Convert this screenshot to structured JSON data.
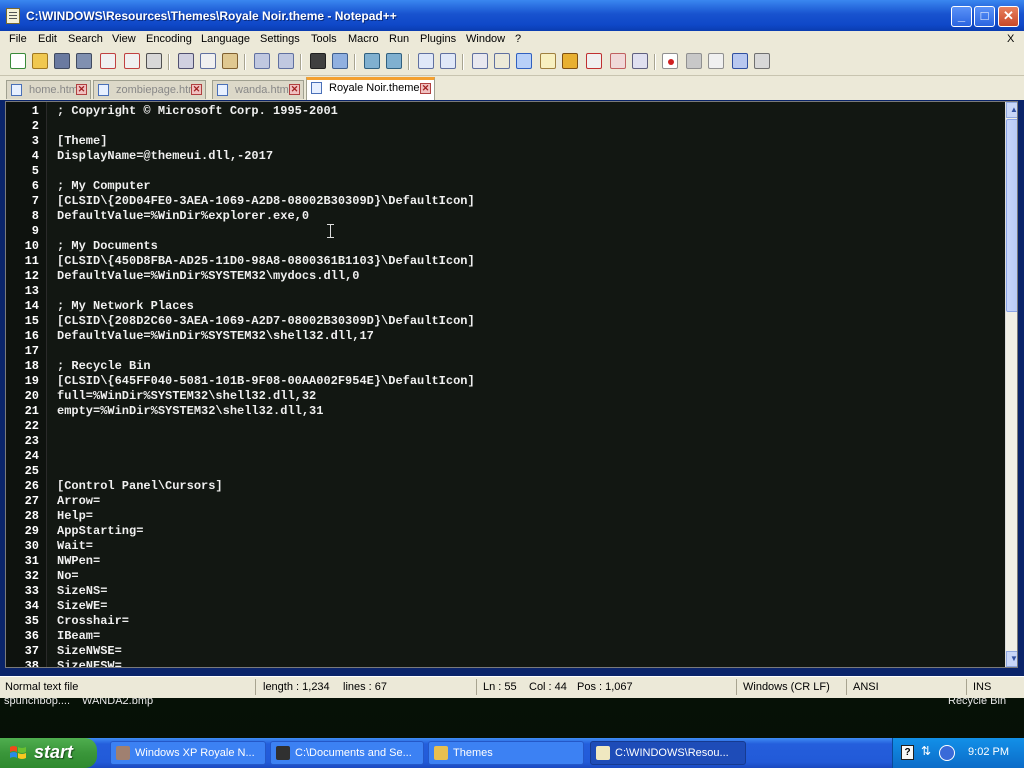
{
  "window": {
    "title": "C:\\WINDOWS\\Resources\\Themes\\Royale Noir.theme - Notepad++"
  },
  "menu": [
    "File",
    "Edit",
    "Search",
    "View",
    "Encoding",
    "Language",
    "Settings",
    "Tools",
    "Macro",
    "Run",
    "Plugins",
    "Window",
    "?"
  ],
  "menu_close": "X",
  "tabs": [
    {
      "label": "home.html",
      "active": false
    },
    {
      "label": "zombiepage.html",
      "active": false
    },
    {
      "label": "wanda.html",
      "active": false
    },
    {
      "label": "Royale Noir.theme",
      "active": true
    }
  ],
  "editor": {
    "lines": [
      {
        "n": "1",
        "text": "; Copyright © Microsoft Corp. 1995-2001"
      },
      {
        "n": "2",
        "text": ""
      },
      {
        "n": "3",
        "text": "[Theme]"
      },
      {
        "n": "4",
        "text": "DisplayName=@themeui.dll,-2017"
      },
      {
        "n": "5",
        "text": ""
      },
      {
        "n": "6",
        "text": "; My Computer"
      },
      {
        "n": "7",
        "text": "[CLSID\\{20D04FE0-3AEA-1069-A2D8-08002B30309D}\\DefaultIcon]"
      },
      {
        "n": "8",
        "text": "DefaultValue=%WinDir%explorer.exe,0"
      },
      {
        "n": "9",
        "text": ""
      },
      {
        "n": "10",
        "text": "; My Documents"
      },
      {
        "n": "11",
        "text": "[CLSID\\{450D8FBA-AD25-11D0-98A8-0800361B1103}\\DefaultIcon]"
      },
      {
        "n": "12",
        "text": "DefaultValue=%WinDir%SYSTEM32\\mydocs.dll,0"
      },
      {
        "n": "13",
        "text": ""
      },
      {
        "n": "14",
        "text": "; My Network Places"
      },
      {
        "n": "15",
        "text": "[CLSID\\{208D2C60-3AEA-1069-A2D7-08002B30309D}\\DefaultIcon]"
      },
      {
        "n": "16",
        "text": "DefaultValue=%WinDir%SYSTEM32\\shell32.dll,17"
      },
      {
        "n": "17",
        "text": ""
      },
      {
        "n": "18",
        "text": "; Recycle Bin"
      },
      {
        "n": "19",
        "text": "[CLSID\\{645FF040-5081-101B-9F08-00AA002F954E}\\DefaultIcon]"
      },
      {
        "n": "20",
        "text": "full=%WinDir%SYSTEM32\\shell32.dll,32"
      },
      {
        "n": "21",
        "text": "empty=%WinDir%SYSTEM32\\shell32.dll,31"
      },
      {
        "n": "22",
        "text": ""
      },
      {
        "n": "23",
        "text": ""
      },
      {
        "n": "24",
        "text": ""
      },
      {
        "n": "25",
        "text": ""
      },
      {
        "n": "26",
        "text": "[Control Panel\\Cursors]"
      },
      {
        "n": "27",
        "text": "Arrow="
      },
      {
        "n": "28",
        "text": "Help="
      },
      {
        "n": "29",
        "text": "AppStarting="
      },
      {
        "n": "30",
        "text": "Wait="
      },
      {
        "n": "31",
        "text": "NWPen="
      },
      {
        "n": "32",
        "text": "No="
      },
      {
        "n": "33",
        "text": "SizeNS="
      },
      {
        "n": "34",
        "text": "SizeWE="
      },
      {
        "n": "35",
        "text": "Crosshair="
      },
      {
        "n": "36",
        "text": "IBeam="
      },
      {
        "n": "37",
        "text": "SizeNWSE="
      },
      {
        "n": "38",
        "text": "SizeNESW="
      }
    ]
  },
  "status": {
    "file_type": "Normal text file",
    "length": "length : 1,234",
    "lines": "lines : 67",
    "ln": "Ln : 55",
    "col": "Col : 44",
    "pos": "Pos : 1,067",
    "eol": "Windows (CR LF)",
    "encoding": "ANSI",
    "mode": "INS"
  },
  "desktop": {
    "label_left_1": "spunchbop....",
    "label_left_2": "WANDA2.bmp",
    "label_right": "Recycle Bin"
  },
  "taskbar": {
    "start_label": "start",
    "tasks": [
      {
        "label": "Windows XP Royale N...",
        "icon_color": "#a08070",
        "active": false
      },
      {
        "label": "C:\\Documents and Se...",
        "icon_color": "#303030",
        "active": false
      },
      {
        "label": "Themes",
        "icon_color": "#e8c050",
        "active": false
      },
      {
        "label": "C:\\WINDOWS\\Resou...",
        "icon_color": "#f0e8c0",
        "active": true
      }
    ],
    "clock": "9:02 PM"
  }
}
